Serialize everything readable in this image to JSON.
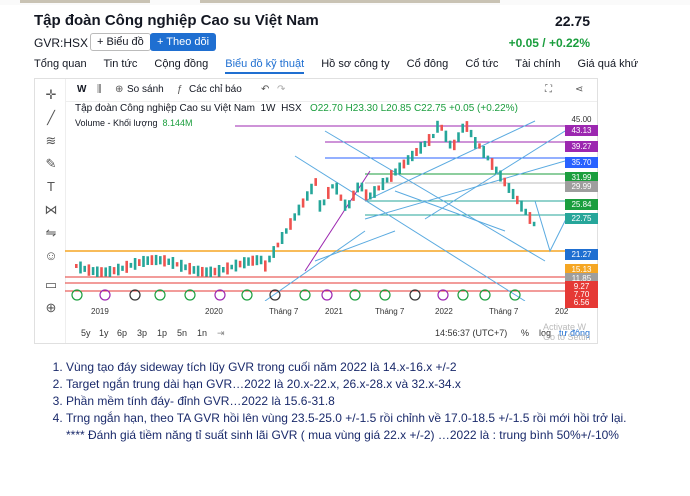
{
  "header": {
    "company_name": "Tập đoàn Công nghiệp Cao su Việt Nam",
    "ticker": "GVR:HSX",
    "follow_button": "+ Biểu đồ",
    "follow_primary_button": "+ Theo dõi",
    "price": "22.75",
    "change": "+0.05 / +0.22%"
  },
  "nav": {
    "tabs": [
      "Tổng quan",
      "Tin tức",
      "Cộng đồng",
      "Biểu đồ kỹ thuật",
      "Hồ sơ công ty",
      "Cổ đông",
      "Cổ tức",
      "Tài chính",
      "Giá quá khứ"
    ],
    "active_index": 3
  },
  "chart_toolbar": {
    "interval": "W",
    "compare": "So sánh",
    "indicators": "Các chỉ báo"
  },
  "chart_legend": {
    "name": "Tập đoàn Công nghiệp Cao su Việt Nam",
    "interval": "1W",
    "exchange": "HSX",
    "ohlc": "O22.70 H23.30 L20.85 C22.75 +0.05 (+0.22%)",
    "volume_label": "Volume - Khối lượng",
    "volume_value": "8.144M"
  },
  "price_axis": {
    "top_value": "45.00",
    "labels": [
      {
        "text": "43.13",
        "color": "#9c27b0"
      },
      {
        "text": "39.27",
        "color": "#9c27b0"
      },
      {
        "text": "35.70",
        "color": "#2962ff"
      },
      {
        "text": "31.99",
        "color": "#1b9e3e"
      },
      {
        "text": "29.99",
        "color": "#9e9e9e"
      },
      {
        "text": "25.84",
        "color": "#1b9e3e"
      },
      {
        "text": "22.75",
        "color": "#26a69a"
      },
      {
        "text": "21.27",
        "color": "#1f6fd1"
      },
      {
        "text": "15.13",
        "color": "#f5a623"
      },
      {
        "text": "11.85",
        "color": "#9e9e9e"
      },
      {
        "text": "9.27",
        "color": "#e53935"
      },
      {
        "text": "7.70",
        "color": "#e53935"
      },
      {
        "text": "6.56",
        "color": "#e53935"
      }
    ]
  },
  "time_axis": {
    "labels": [
      "2019",
      "2020",
      "Tháng 7",
      "2021",
      "Tháng 7",
      "2022",
      "Tháng 7",
      "202"
    ]
  },
  "range_bar": {
    "ranges": [
      "5y",
      "1y",
      "6p",
      "3p",
      "1p",
      "5n",
      "1n"
    ],
    "clock": "14:56:37 (UTC+7)",
    "pct": "%",
    "log": "log",
    "auto": "tự động"
  },
  "watermark": "Activate W\nGo to Settin",
  "notes": {
    "items": [
      "Vùng tạo đáy sideway tích lũy GVR trong cuối năm 2022 là 14.x-16.x +/-2",
      "Target ngắn trung dài hạn GVR…2022 là 20.x-22.x, 26.x-28.x và 32.x-34.x",
      "Phần mềm tính đáy- đỉnh GVR…2022 là 15.6-31.8",
      "Trng ngắn hạn, theo TA GVR hồi lên vùng 23.5-25.0 +/-1.5 rồi chỉnh về 17.0-18.5 +/-1.5 rồi mới hồi trở lại."
    ],
    "extra": "**** Đánh giá tiềm năng tỉ suất sinh lãi GVR ( mua vùng giá 22.x +/-2) …2022 là : trung bình 50%+/-10%"
  }
}
